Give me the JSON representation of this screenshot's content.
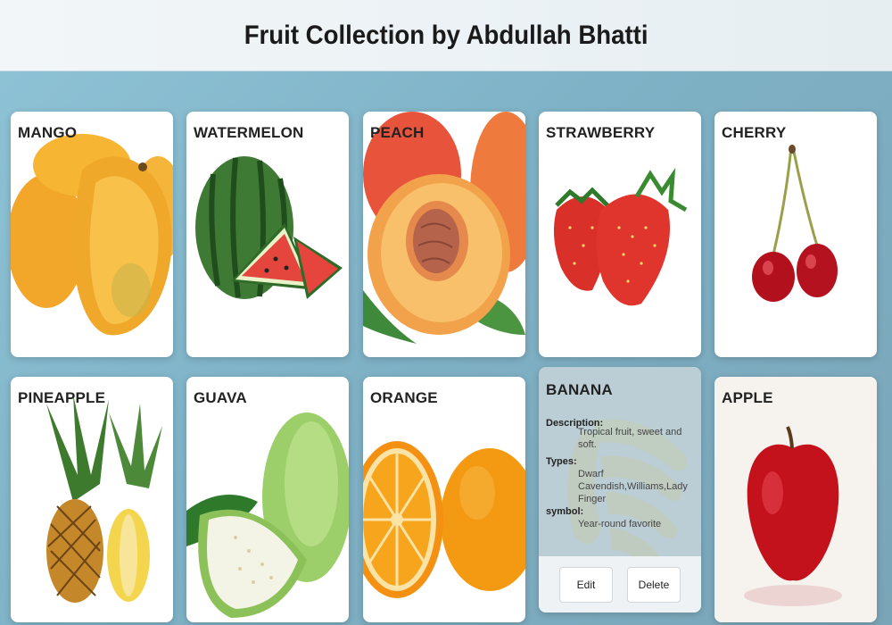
{
  "header": {
    "title": "Fruit Collection by Abdullah Bhatti"
  },
  "fruits": [
    {
      "name": "MANGO"
    },
    {
      "name": "WATERMELON"
    },
    {
      "name": "PEACH"
    },
    {
      "name": "STRAWBERRY"
    },
    {
      "name": "CHERRY"
    },
    {
      "name": "PINEAPPLE"
    },
    {
      "name": "GUAVA"
    },
    {
      "name": "ORANGE"
    },
    {
      "name": "BANANA",
      "description_label": "Description:",
      "description": "Tropical fruit, sweet and soft.",
      "types_label": "Types:",
      "types": "Dwarf Cavendish,Williams,Lady Finger",
      "symbol_label": "symbol:",
      "symbol": "Year-round favorite",
      "edit_label": "Edit",
      "delete_label": "Delete"
    },
    {
      "name": "APPLE"
    }
  ]
}
